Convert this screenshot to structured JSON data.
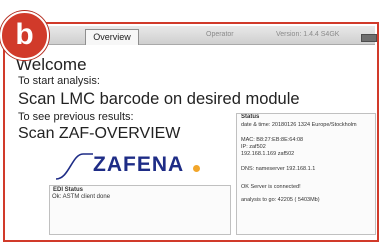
{
  "badge": {
    "letter": "b",
    "color": "#d13a2a"
  },
  "topbar": {
    "tab_label": "Overview",
    "operator_label": "Operator",
    "version_label": "Version: 1.4.4 S4GK",
    "battery_icon": "battery-icon"
  },
  "main": {
    "welcome": "Welcome",
    "instr1": "To start analysis:",
    "cmd1": "Scan LMC barcode on desired module",
    "instr2": "To see previous results:",
    "cmd2": "Scan ZAF-OVERVIEW"
  },
  "logo": {
    "text": "ZAFENA",
    "brand_color": "#1e2c86",
    "dot_color": "#f2a62b"
  },
  "edi": {
    "title": "EDI Status",
    "line": "Ok: ASTM client done"
  },
  "status": {
    "title": "Status",
    "datetime": "date & time: 20180126 1324 Europe/Stockholm",
    "mac": "MAC: B8:27:EB:8E:64:08",
    "ip": "IP: zaf502",
    "ip_full": "192.168.1.169 zaf502",
    "dns": "DNS: nameserver 192.168.1.1",
    "server": "OK Server is connected!",
    "analysis": "analysis to go: 42205 ( 5403Mb)"
  }
}
